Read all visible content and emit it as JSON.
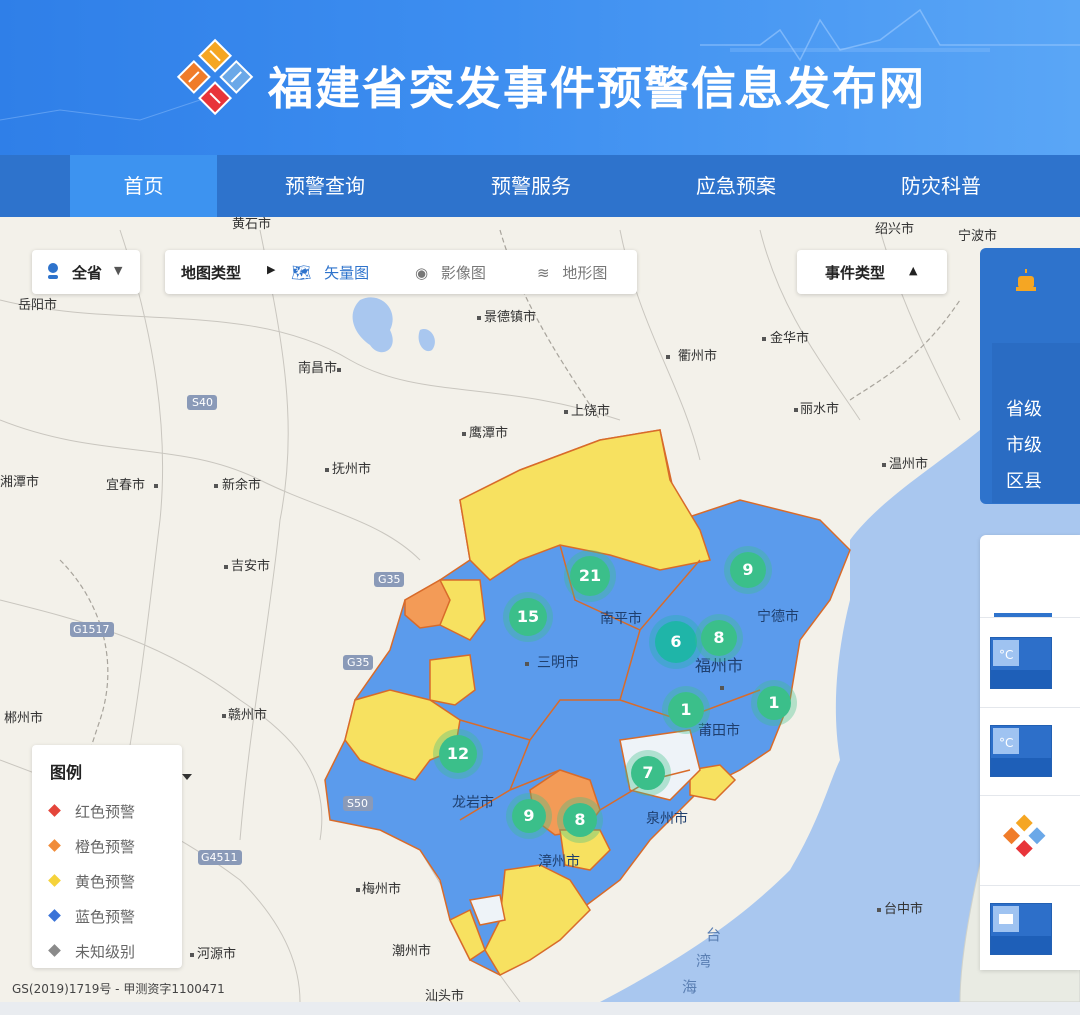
{
  "header": {
    "site_title": "福建省突发事件预警信息发布网",
    "logo_icon": "emblem-logo-icon",
    "colors": {
      "header_bg": "#3d8ef0",
      "nav_bg": "#2e73cc",
      "nav_active": "#3d93f0"
    }
  },
  "nav": [
    {
      "label": "首页",
      "active": true
    },
    {
      "label": "预警查询",
      "active": false
    },
    {
      "label": "预警服务",
      "active": false
    },
    {
      "label": "应急预案",
      "active": false
    },
    {
      "label": "防灾科普",
      "active": false
    }
  ],
  "map_controls": {
    "region_label": "全省",
    "map_type_label": "地图类型",
    "vector_label": "矢量图",
    "image_label": "影像图",
    "terrain_label": "地形图",
    "event_type_label": "事件类型",
    "selected_map_type": "矢量图"
  },
  "legend": {
    "title": "图例",
    "items": [
      {
        "label": "红色预警",
        "color": "#e4453a"
      },
      {
        "label": "橙色预警",
        "color": "#f08c3a"
      },
      {
        "label": "黄色预警",
        "color": "#f5d23a"
      },
      {
        "label": "蓝色预警",
        "color": "#3a73d8"
      },
      {
        "label": "未知级别",
        "color": "#8a8a8a"
      }
    ]
  },
  "copyright": "GS(2019)1719号 - 甲测资字1100471",
  "map_labels": {
    "cities": [
      "南昌市",
      "景德镇市",
      "上饶市",
      "鹰潭市",
      "抚州市",
      "宜春市",
      "新余市",
      "吉安市",
      "赣州市",
      "梅州市",
      "河源市",
      "潮州市",
      "岳阳市",
      "湘潭市",
      "郴州市",
      "衢州市",
      "金华市",
      "丽水市",
      "温州市",
      "绍兴市",
      "宁波市",
      "台中市",
      "南平市",
      "三明市",
      "福州市",
      "宁德市",
      "莆田市",
      "泉州市",
      "龙岩市",
      "漳州市",
      "黄石市",
      "汕头市"
    ],
    "roads": [
      "S40",
      "G35",
      "G1517",
      "S50",
      "G4511"
    ],
    "water": [
      "台",
      "湾",
      "海"
    ]
  },
  "clusters": [
    {
      "count": "21",
      "color": "#3bbf8a"
    },
    {
      "count": "15",
      "color": "#3bbf8a"
    },
    {
      "count": "9",
      "color": "#3bbf8a"
    },
    {
      "count": "6",
      "color": "#1fb5a8"
    },
    {
      "count": "8",
      "color": "#3bbf8a"
    },
    {
      "count": "1",
      "color": "#3bbf8a"
    },
    {
      "count": "1",
      "color": "#3bbf8a"
    },
    {
      "count": "12",
      "color": "#3bbf8a"
    },
    {
      "count": "7",
      "color": "#3bbf8a"
    },
    {
      "count": "9",
      "color": "#3bbf8a"
    },
    {
      "count": "8",
      "color": "#3bbf8a"
    }
  ],
  "side_panel": {
    "rows": [
      "省级",
      "市级",
      "区县"
    ]
  },
  "warning_list": {
    "cards": [
      {
        "icon": "blue-cooling-warning-icon"
      },
      {
        "icon": "blue-cooling-warning-icon"
      },
      {
        "icon": "emblem-logo-icon"
      },
      {
        "icon": "blue-frost-warning-icon"
      }
    ]
  }
}
